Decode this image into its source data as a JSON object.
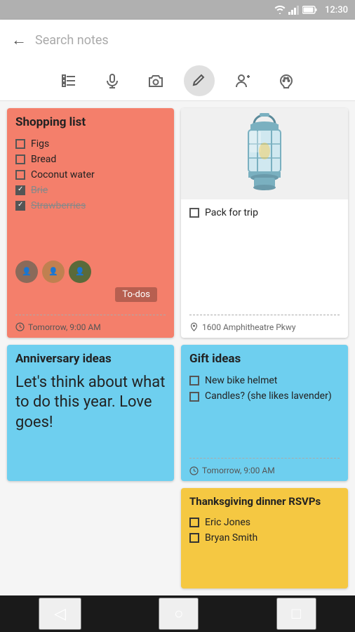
{
  "statusBar": {
    "time": "12:30",
    "wifiIcon": "wifi",
    "signalIcon": "signal",
    "batteryIcon": "battery"
  },
  "topBar": {
    "searchPlaceholder": "Search notes",
    "backLabel": "←"
  },
  "toolbar": {
    "items": [
      {
        "id": "list",
        "icon": "☰",
        "active": false,
        "label": "list-icon"
      },
      {
        "id": "mic",
        "icon": "🎤",
        "active": false,
        "label": "mic-icon"
      },
      {
        "id": "camera",
        "icon": "📷",
        "active": false,
        "label": "camera-icon"
      },
      {
        "id": "draw",
        "icon": "✏️",
        "active": true,
        "label": "draw-icon"
      },
      {
        "id": "person",
        "icon": "👤",
        "active": false,
        "label": "person-icon"
      },
      {
        "id": "palette",
        "icon": "🎨",
        "active": false,
        "label": "palette-icon"
      }
    ]
  },
  "notes": [
    {
      "id": "shopping",
      "type": "checklist",
      "color": "salmon",
      "title": "Shopping list",
      "items": [
        {
          "text": "Figs",
          "checked": false,
          "strikethrough": false
        },
        {
          "text": "Bread",
          "checked": false,
          "strikethrough": false
        },
        {
          "text": "Coconut water",
          "checked": false,
          "strikethrough": false
        },
        {
          "text": "Brie",
          "checked": true,
          "strikethrough": true
        },
        {
          "text": "Strawberries",
          "checked": true,
          "strikethrough": true
        }
      ],
      "avatars": [
        "A",
        "B",
        "C"
      ],
      "badge": "To-dos",
      "reminder": "Tomorrow, 9:00 AM",
      "hasDivider": true
    },
    {
      "id": "trip",
      "type": "image-check",
      "color": "white",
      "hasImage": true,
      "items": [
        {
          "text": "Pack for trip",
          "checked": false,
          "strikethrough": false
        }
      ],
      "location": "1600 Amphitheatre Pkwy",
      "hasDivider": true
    },
    {
      "id": "anniversary",
      "type": "text",
      "color": "blue",
      "title": "Anniversary ideas",
      "body": "Let's think about what to do this year. Love goes!",
      "hasDivider": false
    },
    {
      "id": "gift",
      "type": "checklist",
      "color": "blue",
      "title": "Gift ideas",
      "items": [
        {
          "text": "New bike helmet",
          "checked": false,
          "strikethrough": false
        },
        {
          "text": "Candles? (she likes lavender)",
          "checked": false,
          "strikethrough": false
        }
      ],
      "reminder": "Tomorrow, 9:00 AM",
      "hasDivider": true
    },
    {
      "id": "thanksgiving",
      "type": "checklist",
      "color": "yellow",
      "title": "Thanksgiving dinner RSVPs",
      "items": [
        {
          "text": "Eric Jones",
          "checked": false,
          "strikethrough": false
        },
        {
          "text": "Bryan Smith",
          "checked": false,
          "strikethrough": false
        }
      ],
      "hasDivider": false
    }
  ],
  "bottomNav": {
    "back": "◁",
    "home": "○",
    "recent": "□"
  }
}
